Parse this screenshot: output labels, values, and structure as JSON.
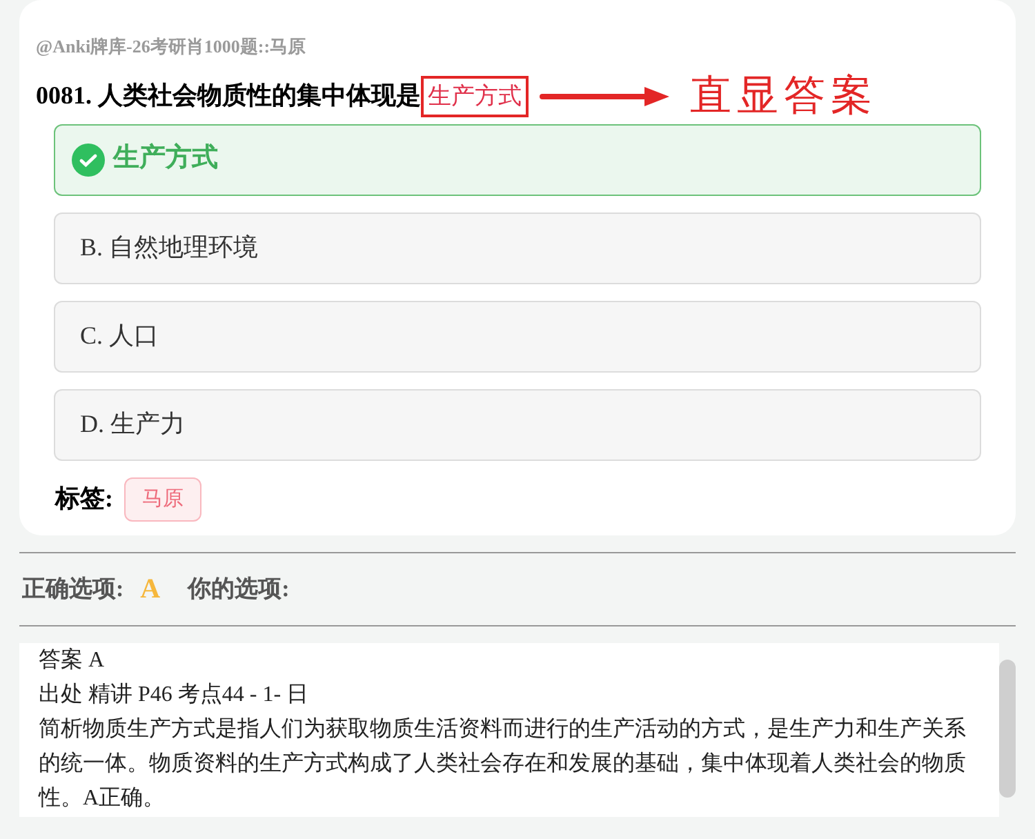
{
  "deck_path": "@Anki牌库-26考研肖1000题::马原",
  "question": {
    "number": "0081.",
    "text": "人类社会物质性的集中体现是",
    "answer": "生产方式"
  },
  "annotation": {
    "label": "直显答案"
  },
  "options": [
    {
      "text": "生产方式",
      "selected": true
    },
    {
      "text": "B. 自然地理环境",
      "selected": false
    },
    {
      "text": "C. 人口",
      "selected": false
    },
    {
      "text": "D. 生产力",
      "selected": false
    }
  ],
  "tags": {
    "label": "标签:",
    "items": [
      "马原"
    ]
  },
  "summary": {
    "correct_label": "正确选项:",
    "correct_value": "A",
    "yours_label": "你的选项:"
  },
  "explanation": [
    "答案 A",
    "出处 精讲 P46 考点44 - 1- 日",
    "简析物质生产方式是指人们为获取物质生活资料而进行的生产活动的方式，是生产力和生产关系的统一体。物质资料的生产方式构成了人类社会存在和发展的基础，集中体现着人类社会的物质性。A正确。"
  ]
}
